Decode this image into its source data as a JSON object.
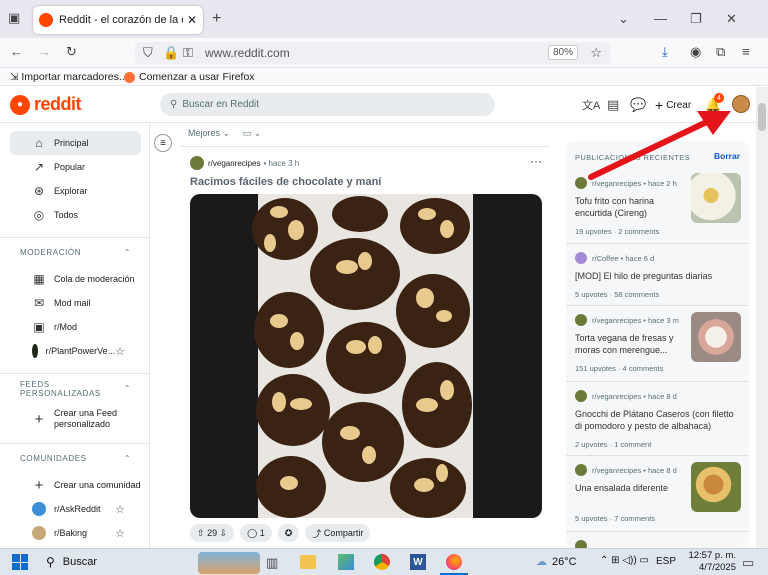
{
  "browser": {
    "tab_title": "Reddit - el corazón de la conve",
    "url": "www.reddit.com",
    "zoom": "80%",
    "bookmarks": [
      "Importar marcadores...",
      "Comenzar a usar Firefox"
    ]
  },
  "header": {
    "logo_text": "reddit",
    "search_placeholder": "Buscar en Reddit",
    "create_label": "Crear",
    "notification_count": "4"
  },
  "sidebar": {
    "main": [
      {
        "label": "Principal",
        "icon": "home-icon"
      },
      {
        "label": "Popular",
        "icon": "popular-icon"
      },
      {
        "label": "Explorar",
        "icon": "explore-icon"
      },
      {
        "label": "Todos",
        "icon": "all-icon"
      }
    ],
    "moderation_title": "MODERACIÓN",
    "moderation": [
      "Cola de moderación",
      "Mod mail",
      "r/Mod",
      "r/PlantPowerVe..."
    ],
    "feeds_title": "FEEDS PERSONALIZADAS",
    "create_feed": "Crear una Feed personalizado",
    "communities_title": "COMUNIDADES",
    "create_community": "Crear una comunidad",
    "communities": [
      "r/AskReddit",
      "r/Baking"
    ]
  },
  "feed": {
    "sort_label": "Mejores",
    "post": {
      "subreddit": "r/veganrecipes",
      "age": "• hace 3 h",
      "title": "Racimos fáciles de chocolate y maní",
      "votes": "29",
      "comments": "1",
      "share_label": "Compartir"
    }
  },
  "recent": {
    "title": "PUBLICACIONES RECIENTES",
    "clear_label": "Borrar",
    "items": [
      {
        "sub": "r/veganrecipes",
        "age": "• hace 2 h",
        "title": "Tofu frito con harina encurtida (Cireng)",
        "stats": "19 upvotes · 2 comments",
        "thumb": true
      },
      {
        "sub": "r/Coffee",
        "age": "• hace 6 d",
        "title": "[MOD] El hilo de preguntas diarias",
        "stats": "5 upvotes · 58 comments",
        "thumb": false
      },
      {
        "sub": "r/veganrecipes",
        "age": "• hace 3 m",
        "title": "Torta vegana de fresas y moras con merengue...",
        "stats": "151 upvotes · 4 comments",
        "thumb": true
      },
      {
        "sub": "r/veganrecipes",
        "age": "• hace 8 d",
        "title": "Gnocchi de Plátano Caseros (con filetto di pomodoro y pesto de albahaca)",
        "stats": "2 upvotes · 1 comment",
        "thumb": false
      },
      {
        "sub": "r/veganrecipes",
        "age": "• hace 8 d",
        "title": "Una ensalada diferente",
        "stats": "5 upvotes · 7 comments",
        "thumb": true
      }
    ]
  },
  "taskbar": {
    "search_label": "Buscar",
    "temperature": "26°C",
    "language": "ESP",
    "time": "12:57 p. m.",
    "date": "4/7/2025"
  },
  "colors": {
    "brand": "#ff4500",
    "link": "#0a58ca",
    "arrow": "#e4141b"
  }
}
